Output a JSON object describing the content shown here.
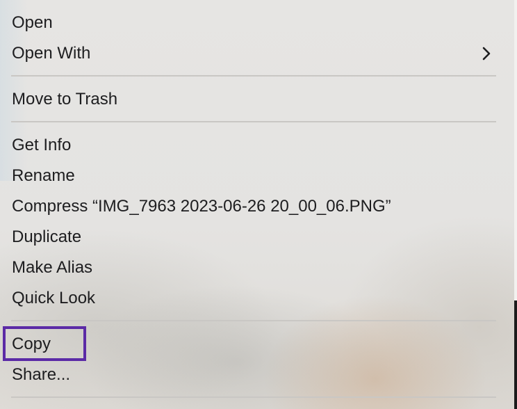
{
  "menu": {
    "items": [
      {
        "label": "Open"
      },
      {
        "label": "Open With",
        "has_submenu": true
      },
      {
        "label": "Move to Trash"
      },
      {
        "label": "Get Info"
      },
      {
        "label": "Rename"
      },
      {
        "label": "Compress “IMG_7963 2023-06-26 20_00_06.PNG”"
      },
      {
        "label": "Duplicate"
      },
      {
        "label": "Make Alias"
      },
      {
        "label": "Quick Look"
      },
      {
        "label": "Copy",
        "highlighted": true
      },
      {
        "label": "Share..."
      }
    ],
    "submenu_icon": "chevron-right-icon",
    "highlight_color": "#5b2aa6"
  }
}
